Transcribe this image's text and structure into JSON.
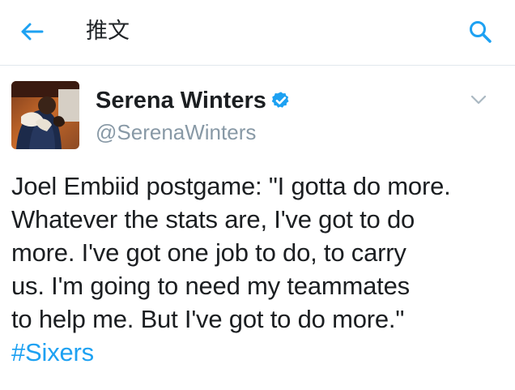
{
  "header": {
    "title": "推文",
    "back_icon": "arrow-left-icon",
    "search_icon": "search-icon",
    "accent_color": "#1da1f2"
  },
  "tweet": {
    "author_name": "Serena Winters",
    "handle": "@SerenaWinters",
    "verified": true,
    "verified_icon": "verified-badge-icon",
    "menu_icon": "chevron-down-icon",
    "text_lines": [
      "Joel Embiid postgame: \"I gotta do more.",
      "Whatever the stats are, I've got to do",
      "more. I've got one job to do, to carry",
      "us. I'm going to need my teammates",
      "to help me. But I've got to do more.\""
    ],
    "hashtag": "#Sixers"
  }
}
